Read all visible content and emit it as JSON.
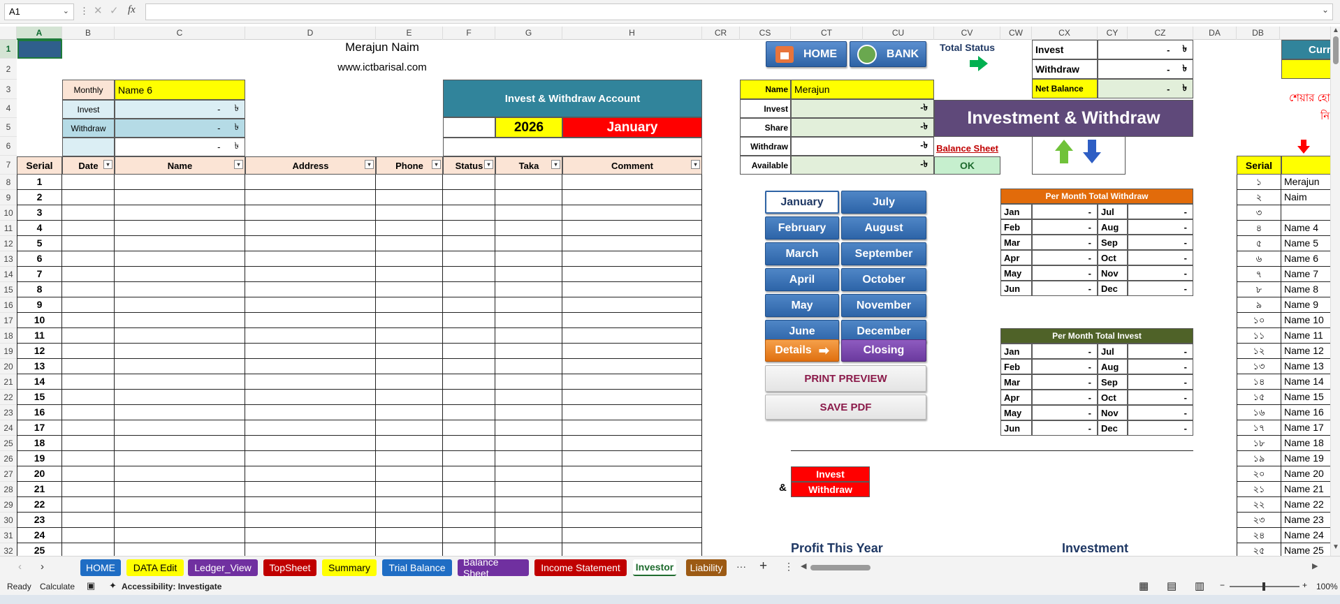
{
  "formula_bar": {
    "cell_ref": "A1",
    "fx": "fx"
  },
  "columns": [
    "A",
    "B",
    "C",
    "D",
    "E",
    "F",
    "G",
    "H",
    "CR",
    "CS",
    "CT",
    "CU",
    "CV",
    "CW",
    "CX",
    "CY",
    "CZ",
    "DA",
    "DB"
  ],
  "header": {
    "title": "Merajun Naim",
    "website": "www.ictbarisal.com"
  },
  "summary_box": {
    "monthly_label": "Monthly",
    "monthly_value": "Name 6",
    "invest_label": "Invest",
    "invest_value": "-",
    "withdraw_label": "Withdraw",
    "withdraw_value": "-",
    "total_value": "-",
    "currency": "৳"
  },
  "account_box": {
    "title": "Invest & Withdraw Account",
    "year": "2026",
    "month": "January"
  },
  "table_headers": {
    "serial": "Serial",
    "date": "Date",
    "name": "Name",
    "address": "Address",
    "phone": "Phone",
    "status": "Status",
    "taka": "Taka",
    "comment": "Comment"
  },
  "serials": [
    "1",
    "2",
    "3",
    "4",
    "5",
    "6",
    "7",
    "8",
    "9",
    "10",
    "11",
    "12",
    "13",
    "14",
    "15",
    "16",
    "17",
    "18",
    "19",
    "20",
    "21",
    "22",
    "23",
    "24",
    "25"
  ],
  "row_numbers": [
    "1",
    "2",
    "3",
    "4",
    "5",
    "6",
    "7",
    "8",
    "9",
    "10",
    "11",
    "12",
    "13",
    "14",
    "15",
    "16",
    "17",
    "18",
    "19",
    "20",
    "21",
    "22",
    "23",
    "24",
    "25",
    "26",
    "27",
    "28",
    "29",
    "30",
    "31",
    "32"
  ],
  "nav_buttons": {
    "home": "HOME",
    "bank": "BANK"
  },
  "total_status": {
    "label": "Total Status",
    "invest_label": "Invest",
    "withdraw_label": "Withdraw",
    "net_label": "Net Balance",
    "invest_value": "-",
    "withdraw_value": "-",
    "net_value": "-",
    "currency": "৳"
  },
  "investor_info": {
    "name_label": "Name",
    "name_value": "Merajun",
    "invest_label": "Invest",
    "share_label": "Share",
    "withdraw_label": "Withdraw",
    "available_label": "Available",
    "amount": "-৳"
  },
  "banner": "Investment & Withdraw",
  "balance_sheet_link": "Balance Sheet",
  "ok_label": "OK",
  "months_left": [
    "January",
    "February",
    "March",
    "April",
    "May",
    "June"
  ],
  "months_right": [
    "July",
    "August",
    "September",
    "October",
    "November",
    "December"
  ],
  "details_button": "Details",
  "closing_button": "Closing",
  "print_preview": "PRINT PREVIEW",
  "save_pdf": "SAVE PDF",
  "withdraw_table": {
    "title": "Per Month Total  Withdraw",
    "rows": [
      [
        "Jan",
        "-",
        "Jul",
        "-"
      ],
      [
        "Feb",
        "-",
        "Aug",
        "-"
      ],
      [
        "Mar",
        "-",
        "Sep",
        "-"
      ],
      [
        "Apr",
        "-",
        "Oct",
        "-"
      ],
      [
        "May",
        "-",
        "Nov",
        "-"
      ],
      [
        "Jun",
        "-",
        "Dec",
        "-"
      ]
    ]
  },
  "invest_table": {
    "title": "Per Month Total  Invest",
    "rows": [
      [
        "Jan",
        "-",
        "Jul",
        "-"
      ],
      [
        "Feb",
        "-",
        "Aug",
        "-"
      ],
      [
        "Mar",
        "-",
        "Sep",
        "-"
      ],
      [
        "Apr",
        "-",
        "Oct",
        "-"
      ],
      [
        "May",
        "-",
        "Nov",
        "-"
      ],
      [
        "Jun",
        "-",
        "Dec",
        "-"
      ]
    ]
  },
  "legend": {
    "amp": "&",
    "invest": "Invest",
    "withdraw": "Withdraw"
  },
  "profit_label": "Profit This Year",
  "investment_label": "Investment",
  "side_list": {
    "header": "Serial",
    "partial_header": "Curr",
    "bengali_text_1": "শেয়ার হো",
    "bengali_text_2": "নি",
    "items": [
      [
        "১",
        "Merajun"
      ],
      [
        "২",
        "Naim"
      ],
      [
        "৩",
        ""
      ],
      [
        "৪",
        "Name 4"
      ],
      [
        "৫",
        "Name 5"
      ],
      [
        "৬",
        "Name 6"
      ],
      [
        "৭",
        "Name 7"
      ],
      [
        "৮",
        "Name 8"
      ],
      [
        "৯",
        "Name 9"
      ],
      [
        "১০",
        "Name 10"
      ],
      [
        "১১",
        "Name 11"
      ],
      [
        "১২",
        "Name 12"
      ],
      [
        "১৩",
        "Name 13"
      ],
      [
        "১৪",
        "Name 14"
      ],
      [
        "১৫",
        "Name 15"
      ],
      [
        "১৬",
        "Name 16"
      ],
      [
        "১৭",
        "Name 17"
      ],
      [
        "১৮",
        "Name 18"
      ],
      [
        "১৯",
        "Name 19"
      ],
      [
        "২০",
        "Name 20"
      ],
      [
        "২১",
        "Name 21"
      ],
      [
        "২২",
        "Name 22"
      ],
      [
        "২৩",
        "Name 23"
      ],
      [
        "২৪",
        "Name 24"
      ],
      [
        "২৫",
        "Name 25"
      ]
    ]
  },
  "sheet_tabs": [
    {
      "label": "HOME",
      "bg": "#1f6dc4",
      "fg": "#ffffff"
    },
    {
      "label": "DATA Edit",
      "bg": "#ffff00",
      "fg": "#000000"
    },
    {
      "label": "Ledger_View",
      "bg": "#7030a0",
      "fg": "#ffffff"
    },
    {
      "label": "TopSheet",
      "bg": "#c00000",
      "fg": "#ffffff"
    },
    {
      "label": "Summary",
      "bg": "#ffff00",
      "fg": "#000000"
    },
    {
      "label": "Trial Balance",
      "bg": "#1f6dc4",
      "fg": "#ffffff"
    },
    {
      "label": "Balance Sheet",
      "bg": "#7030a0",
      "fg": "#ffffff"
    },
    {
      "label": "Income Statement",
      "bg": "#c00000",
      "fg": "#ffffff"
    },
    {
      "label": "Investor",
      "bg": "#ffffff",
      "fg": "#1e6b2e"
    },
    {
      "label": "Liability",
      "bg": "#9c5a14",
      "fg": "#ffffff"
    }
  ],
  "more_tabs": "···",
  "add_sheet": "+",
  "status_bar": {
    "ready": "Ready",
    "calculate": "Calculate",
    "accessibility": "Accessibility: Investigate",
    "zoom": "100%"
  }
}
